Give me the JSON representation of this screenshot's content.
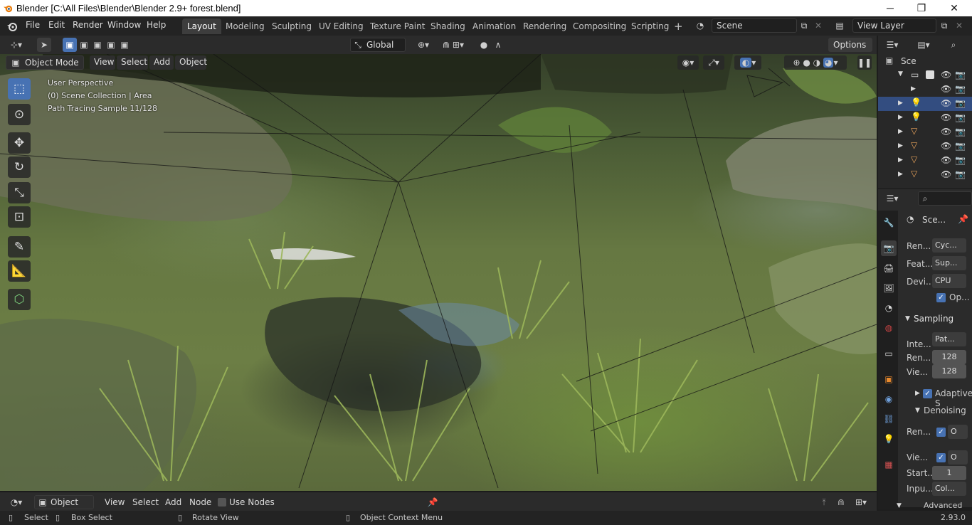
{
  "window": {
    "title": "Blender [C:\\All Files\\Blender\\Blender 2.9+ forest.blend]",
    "minimize": "─",
    "maximize": "❐",
    "close": "✕"
  },
  "menu": {
    "file": "File",
    "edit": "Edit",
    "render": "Render",
    "window": "Window",
    "help": "Help"
  },
  "workspaces": [
    "Layout",
    "Modeling",
    "Sculpting",
    "UV Editing",
    "Texture Paint",
    "Shading",
    "Animation",
    "Rendering",
    "Compositing",
    "Scripting"
  ],
  "add_workspace": "+",
  "scene": {
    "name": "Scene"
  },
  "view_layer": {
    "name": "View Layer"
  },
  "viewport_header": {
    "transform_orientation": "Global",
    "options": "Options",
    "mode": "Object Mode",
    "view": "View",
    "select": "Select",
    "add": "Add",
    "object": "Object"
  },
  "overlay_text": {
    "perspective": "User Perspective",
    "collection": "(0) Scene Collection | Area",
    "sampling": "Path Tracing Sample 11/128"
  },
  "outliner": {
    "root": "Sce"
  },
  "properties": {
    "context": "Sce...",
    "render_engine": {
      "label": "Ren...",
      "value": "Cyc..."
    },
    "feature_set": {
      "label": "Feat...",
      "value": "Sup..."
    },
    "device": {
      "label": "Devi...",
      "value": "CPU"
    },
    "open_shading": {
      "label": "Op..."
    },
    "sampling": {
      "title": "Sampling",
      "integrator": {
        "label": "Inte...",
        "value": "Pat..."
      },
      "render": {
        "label": "Ren...",
        "value": "128"
      },
      "viewport": {
        "label": "Vie...",
        "value": "128"
      }
    },
    "adaptive": "Adaptive S",
    "denoising": {
      "title": "Denoising",
      "render": {
        "label": "Ren...",
        "value": "O"
      },
      "viewport": {
        "label": "Vie...",
        "value": "O"
      },
      "start": {
        "label": "Start...",
        "value": "1"
      },
      "input": {
        "label": "Inpu...",
        "value": "Col..."
      }
    },
    "advanced": "Advanced"
  },
  "node_header": {
    "type": "Object",
    "view": "View",
    "select": "Select",
    "add": "Add",
    "node": "Node",
    "use_nodes": "Use Nodes"
  },
  "statusbar": {
    "select": "Select",
    "box_select": "Box Select",
    "rotate": "Rotate View",
    "context": "Object Context Menu",
    "version": "2.93.0"
  },
  "colors": {
    "accent": "#4772b3",
    "selected_row": "#334d80"
  }
}
